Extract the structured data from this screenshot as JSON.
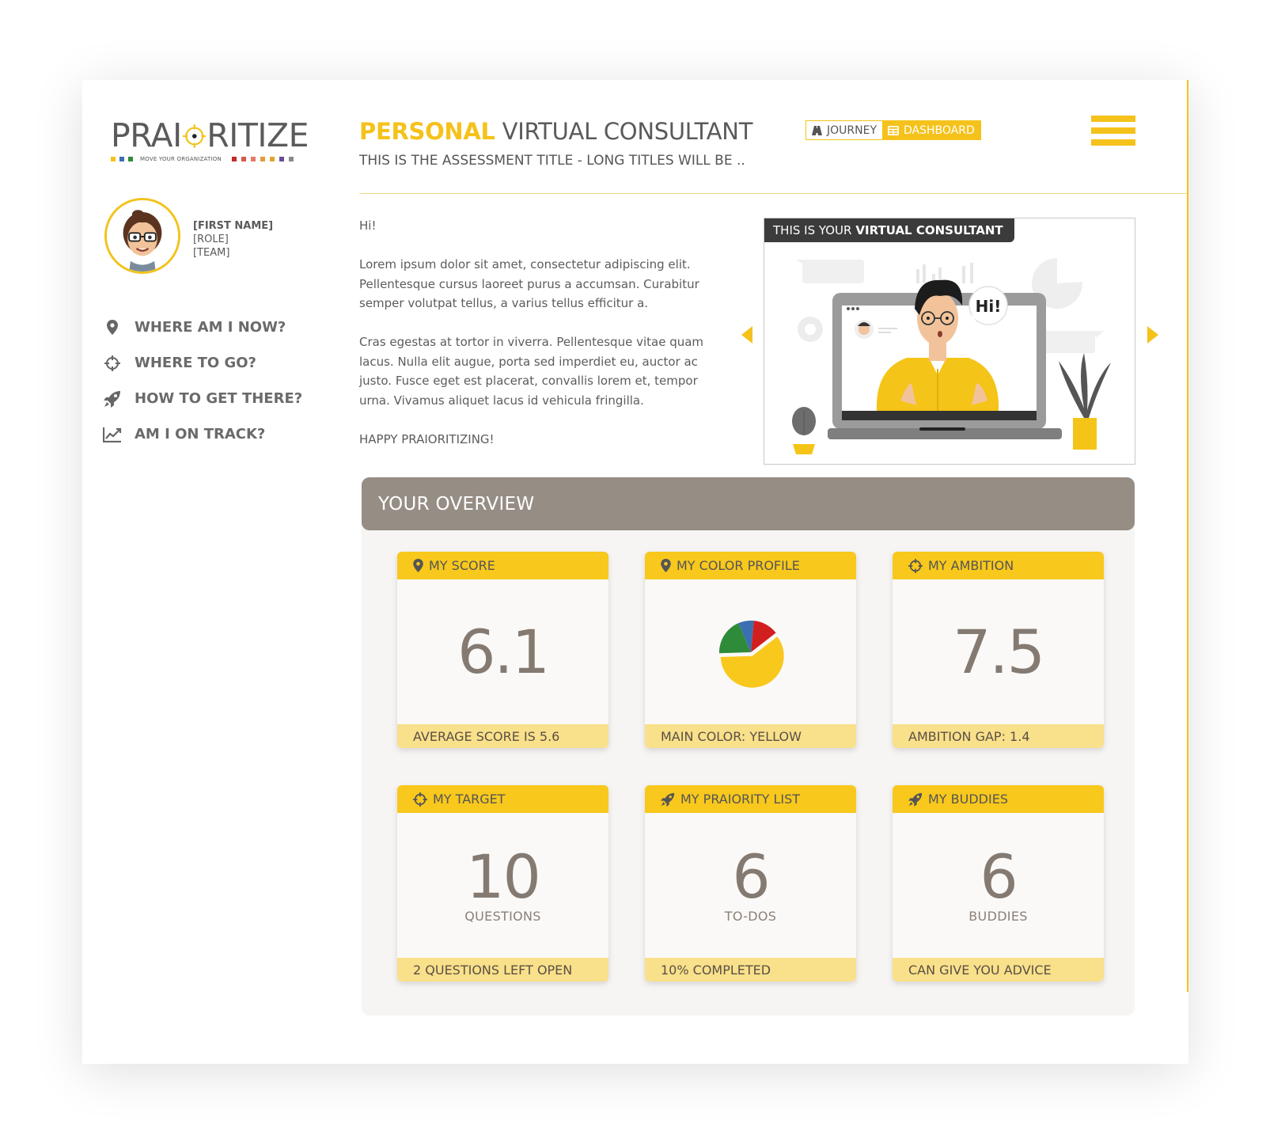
{
  "logo": {
    "text_left": "PRAI",
    "text_right": "RITIZE",
    "tagline": "MOVE YOUR ORGANIZATION",
    "squares_left": [
      "#f2c31b",
      "#3a6fb0",
      "#2f8b3e"
    ],
    "squares_right": [
      "#c62828",
      "#d8584a",
      "#e57a6b",
      "#e39a3d",
      "#e0a52a",
      "#6a4c93",
      "#8a8a8a"
    ]
  },
  "profile": {
    "first_name": "[FIRST NAME]",
    "role": "[ROLE]",
    "team": "[TEAM]"
  },
  "nav": {
    "items": [
      {
        "label": "WHERE AM I NOW?",
        "icon": "map-pin-icon"
      },
      {
        "label": "WHERE TO GO?",
        "icon": "crosshair-icon"
      },
      {
        "label": "HOW TO GET THERE?",
        "icon": "rocket-icon"
      },
      {
        "label": "AM I ON TRACK?",
        "icon": "trend-chart-icon"
      }
    ]
  },
  "header": {
    "title_accent": "PERSONAL",
    "title_rest": "VIRTUAL CONSULTANT",
    "subtitle": "THIS IS THE ASSESSMENT TITLE -  LONG TITLES WILL BE ..",
    "toggle": {
      "journey": "JOURNEY",
      "dashboard": "DASHBOARD",
      "active": "dashboard"
    }
  },
  "intro": {
    "greeting": "Hi!",
    "para1": "Lorem ipsum dolor sit amet, consectetur adipiscing elit. Pellentesque cursus laoreet purus a accumsan. Curabitur semper volutpat tellus, a varius tellus efficitur a.",
    "para2": "Cras egestas at tortor in viverra. Pellentesque vitae quam lacus. Nulla elit augue, porta sed imperdiet eu, auctor ac justo. Fusce eget est placerat, convallis lorem et, tempor urna. Vivamus aliquet lacus id vehicula fringilla.",
    "sign_off": "HAPPY PRAIORITIZING!"
  },
  "consultant": {
    "label_prefix": "THIS IS YOUR",
    "label_bold": "VIRTUAL CONSULTANT",
    "speech": "Hi!"
  },
  "overview": {
    "title": "YOUR OVERVIEW",
    "tiles": [
      {
        "title": "MY SCORE",
        "icon": "map-pin-icon",
        "value": "6.1",
        "unit": "",
        "footer": "AVERAGE SCORE IS 5.6"
      },
      {
        "title": "MY COLOR PROFILE",
        "icon": "map-pin-icon",
        "value": "",
        "unit": "",
        "footer": "MAIN COLOR: YELLOW",
        "pie": [
          {
            "color": "#f8c81c",
            "share": 0.6
          },
          {
            "color": "#2e8b3a",
            "share": 0.19
          },
          {
            "color": "#3b6fb0",
            "share": 0.08
          },
          {
            "color": "#d11f1f",
            "share": 0.13
          }
        ]
      },
      {
        "title": "MY AMBITION",
        "icon": "crosshair-icon",
        "value": "7.5",
        "unit": "",
        "footer": "AMBITION GAP: 1.4"
      },
      {
        "title": "MY TARGET",
        "icon": "crosshair-icon",
        "value": "10",
        "unit": "QUESTIONS",
        "footer": "2 QUESTIONS LEFT OPEN"
      },
      {
        "title": "MY PRAIORITY LIST",
        "icon": "rocket-icon",
        "value": "6",
        "unit": "TO-DOS",
        "footer": "10% COMPLETED"
      },
      {
        "title": "MY BUDDIES",
        "icon": "rocket-icon",
        "value": "6",
        "unit": "BUDDIES",
        "footer": "CAN GIVE YOU ADVICE"
      }
    ]
  },
  "colors": {
    "accent": "#f5c21b",
    "overview_header": "#968d84",
    "tile_footer": "#f9e08a"
  }
}
